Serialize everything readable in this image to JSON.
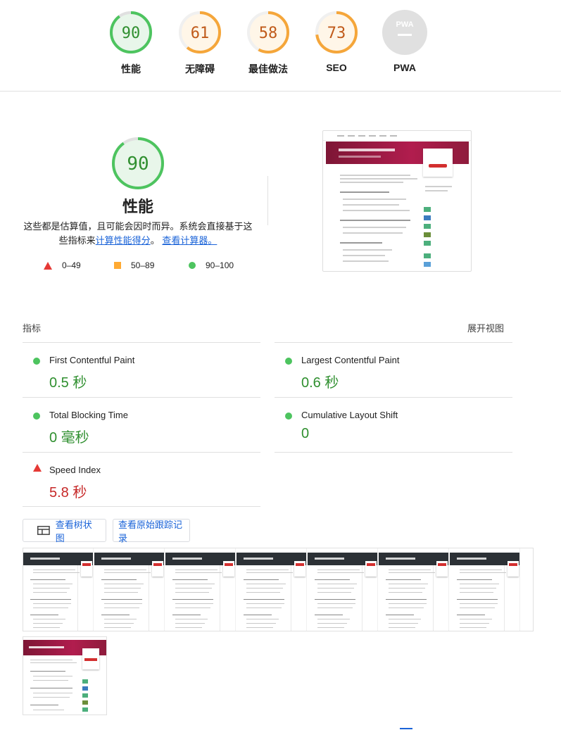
{
  "categories": [
    {
      "label": "性能",
      "score": "90",
      "status": "pass"
    },
    {
      "label": "无障碍",
      "score": "61",
      "status": "average"
    },
    {
      "label": "最佳做法",
      "score": "58",
      "status": "average"
    },
    {
      "label": "SEO",
      "score": "73",
      "status": "average"
    },
    {
      "label": "PWA",
      "score": "",
      "status": "na"
    }
  ],
  "performance": {
    "score": "90",
    "title": "性能",
    "desc_prefix": "这些都是估算值，且可能会因时而异。系统会直接基于这些指标来",
    "link_calc": "计算性能得分",
    "desc_mid": "。",
    "link_calculator": "查看计算器。"
  },
  "legend": {
    "fail": "0–49",
    "average": "50–89",
    "pass": "90–100"
  },
  "metrics_header": {
    "title": "指标",
    "expand": "展开视图"
  },
  "metrics": [
    {
      "name": "First Contentful Paint",
      "value": "0.5 秒",
      "status": "pass"
    },
    {
      "name": "Largest Contentful Paint",
      "value": "0.6 秒",
      "status": "pass"
    },
    {
      "name": "Total Blocking Time",
      "value": "0 毫秒",
      "status": "pass"
    },
    {
      "name": "Cumulative Layout Shift",
      "value": "0",
      "status": "pass"
    },
    {
      "name": "Speed Index",
      "value": "5.8 秒",
      "status": "fail"
    }
  ],
  "buttons": {
    "treemap": "查看树状图",
    "trace": "查看原始跟踪记录"
  },
  "colors": {
    "pass": "#0cce6b",
    "average": "#ffa400",
    "fail": "#ff4e42",
    "link": "#1a63d8"
  },
  "icons": {
    "pwa": "pwa-badge-icon",
    "treemap": "treemap-icon"
  }
}
